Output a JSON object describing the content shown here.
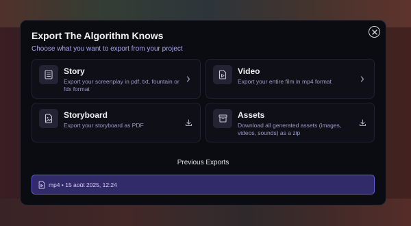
{
  "modal": {
    "title": "Export The Algorithm Knows",
    "subtitle": "Choose what you want to export from your project",
    "close_icon": "close-circle-icon"
  },
  "options": [
    {
      "title": "Story",
      "description": "Export your screenplay in pdf, txt, fountain or fdx format",
      "icon": "document-icon",
      "action_icon": "chevron-right-icon"
    },
    {
      "title": "Video",
      "description": "Export your entire film in mp4 format",
      "icon": "video-file-icon",
      "action_icon": "chevron-right-icon"
    },
    {
      "title": "Storyboard",
      "description": "Export your storyboard as PDF",
      "icon": "image-file-icon",
      "action_icon": "download-icon"
    },
    {
      "title": "Assets",
      "description": "Download all generated assets (images, videos, sounds) as a zip",
      "icon": "archive-icon",
      "action_icon": "download-icon"
    }
  ],
  "previous_exports": {
    "heading": "Previous Exports",
    "items": [
      {
        "label": "mp4 • 15 août 2025, 12:24",
        "icon": "video-file-icon"
      }
    ]
  },
  "colors": {
    "accent": "#6a5fd6",
    "accent_bg": "#322b6a",
    "subtitle": "#a9a6f0",
    "modal_bg": "#0b0b12"
  }
}
